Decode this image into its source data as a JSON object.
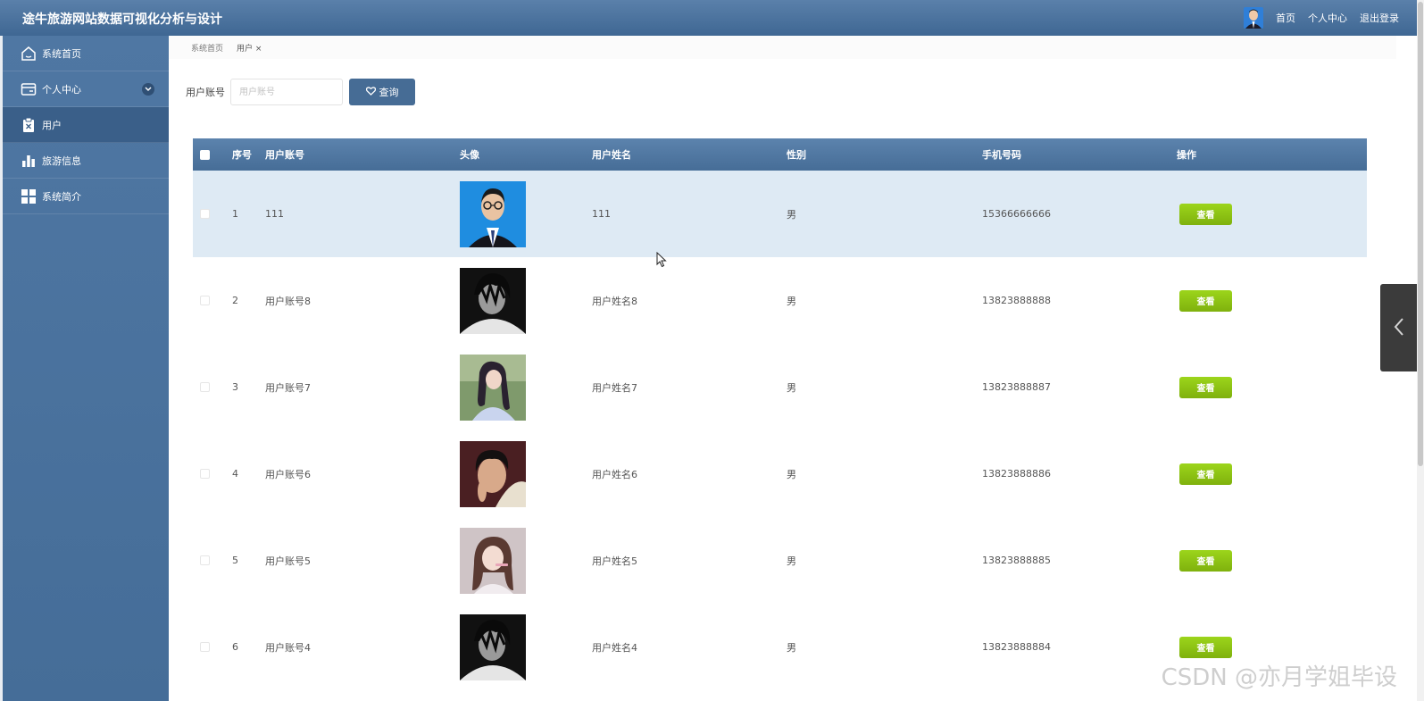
{
  "app": {
    "title": "途牛旅游网站数据可视化分析与设计",
    "top_links": [
      "首页",
      "个人中心",
      "退出登录"
    ]
  },
  "sidebar": {
    "items": [
      {
        "label": "系统首页",
        "icon": "home-icon"
      },
      {
        "label": "个人中心",
        "icon": "wallet-icon",
        "expandable": true
      },
      {
        "label": "用户",
        "icon": "clipboard-icon",
        "active": true
      },
      {
        "label": "旅游信息",
        "icon": "bar-chart-icon"
      },
      {
        "label": "系统简介",
        "icon": "grid-icon"
      }
    ]
  },
  "breadcrumb": {
    "items": [
      "系统首页",
      "用户"
    ],
    "close": "×"
  },
  "search": {
    "label": "用户账号",
    "placeholder": "用户账号",
    "button": "查询"
  },
  "table": {
    "headers": [
      "序号",
      "用户账号",
      "头像",
      "用户姓名",
      "性别",
      "手机号码",
      "操作"
    ],
    "rows": [
      {
        "no": "1",
        "account": "111",
        "avatar": "id-photo-man",
        "name": "111",
        "sex": "男",
        "phone": "15366666666",
        "action": "查看"
      },
      {
        "no": "2",
        "account": "用户账号8",
        "avatar": "anime-dark",
        "name": "用户姓名8",
        "sex": "男",
        "phone": "13823888888",
        "action": "查看"
      },
      {
        "no": "3",
        "account": "用户账号7",
        "avatar": "girl-outdoor",
        "name": "用户姓名7",
        "sex": "男",
        "phone": "13823888887",
        "action": "查看"
      },
      {
        "no": "4",
        "account": "用户账号6",
        "avatar": "man-selfie",
        "name": "用户姓名6",
        "sex": "男",
        "phone": "13823888886",
        "action": "查看"
      },
      {
        "no": "5",
        "account": "用户账号5",
        "avatar": "girl-selfie",
        "name": "用户姓名5",
        "sex": "男",
        "phone": "13823888885",
        "action": "查看"
      },
      {
        "no": "6",
        "account": "用户账号4",
        "avatar": "anime-dark",
        "name": "用户姓名4",
        "sex": "男",
        "phone": "13823888884",
        "action": "查看"
      }
    ]
  },
  "watermark": "CSDN @亦月学姐毕设",
  "colors": {
    "topbar": "#4a719c",
    "sidebar": "#4a719c",
    "active_item": "#3a5f89",
    "row_highlight": "#deeaf4",
    "view_button": "#8cc314"
  }
}
